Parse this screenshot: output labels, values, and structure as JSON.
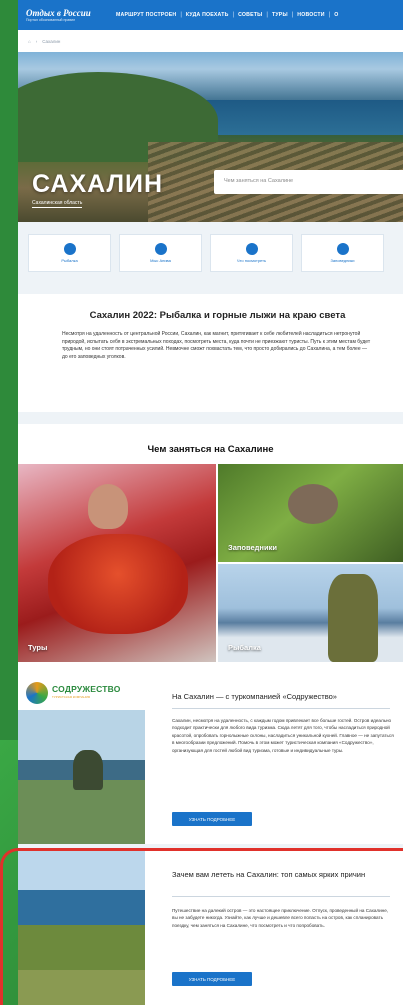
{
  "header": {
    "logo_title": "Отдых в России",
    "logo_tagline": "Портал обоснованный правил",
    "nav": [
      "МАРШРУТ ПОСТРОЕН",
      "КУДА ПОЕХАТЬ",
      "СОВЕТЫ",
      "ТУРЫ",
      "НОВОСТИ",
      "О"
    ]
  },
  "breadcrumb": {
    "home": "⌂",
    "sep": "›",
    "current": "Сахалин"
  },
  "hero": {
    "title": "САХАЛИН",
    "region": "Сахалинская область",
    "search_placeholder": "Чем заняться на Сахалине"
  },
  "categories": [
    {
      "label": "Рыбалка",
      "icon": "fishing-icon"
    },
    {
      "label": "Мыс Анива",
      "icon": "lighthouse-icon"
    },
    {
      "label": "Что посмотреть",
      "icon": "camera-icon"
    },
    {
      "label": "Заповедники",
      "icon": "mountain-icon"
    }
  ],
  "intro": {
    "title": "Сахалин 2022: Рыбалка и горные лыжи на краю света",
    "text": "Несмотря на удаленность от центральной России, Сахалин, как магнит, притягивает к себе любителей насладиться нетронутой природой, испытать себя в экстремальных походах, посмотреть места, куда почти не приезжают туристы. Путь к этим местам будет трудным, но они стоят потраченных усилий. Невмочне сможт похвастать тем, что просто добирались до Сахалина, а тем более — до его заповедных уголков."
  },
  "activities": {
    "title": "Чем заняться на Сахалине",
    "tiles": [
      "Туры",
      "Заповедники",
      "Рыбалка"
    ]
  },
  "tours": [
    {
      "brand_name": "СОДРУЖЕСТВО",
      "brand_tagline": "ТУРИСТСКАЯ КОМПАНИЯ",
      "title": "На Сахалин — с туркомпанией «Содружество»",
      "text": "Сахалин, несмотря на удаленность, с каждым годом привлекает все больше гостей. Остров идеально подходит практически для любого вида туризма. Сюда летят для того, чтобы насладиться природной красотой, опробовать горнолыжные склоны, насладиться уникальной кухней. Главное — не запутаться в многообразии предложений. Помочь в этом может туристическая компания «Содружество», организующая для гостей любой вид туризма, готовые и индивидуальные туры.",
      "button": "УЗНАТЬ ПОДРОБНЕЕ"
    },
    {
      "title": "Зачем вам лететь на Сахалин: топ самых ярких причин",
      "text": "Путешествие на далекий остров — это настоящее приключение. Отпуск, проведенный на Сахалине, вы не забудете никогда. Узнайте, как лучше и дешевле всего попасть на остров, как спланировать поездку, чем заняться на Сахалине, что посмотреть и что попробовать.",
      "button": "УЗНАТЬ ПОДРОБНЕЕ"
    }
  ],
  "colors": {
    "brand": "#1a73c9",
    "highlight": "#e0312b",
    "background_green": "#2e8a3a"
  }
}
